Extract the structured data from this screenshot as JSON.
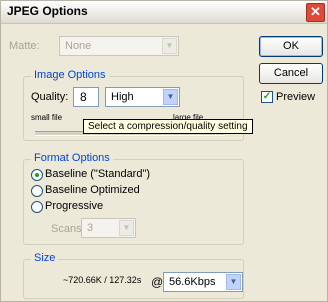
{
  "window": {
    "title": "JPEG Options",
    "close_glyph": "✕"
  },
  "matte": {
    "label": "Matte:",
    "value": "None"
  },
  "buttons": {
    "ok": "OK",
    "cancel": "Cancel"
  },
  "preview": {
    "label": "Preview",
    "checked": true,
    "check_glyph": "✓"
  },
  "image_options": {
    "legend": "Image Options",
    "quality_label": "Quality:",
    "quality_value": "8",
    "quality_select": "High",
    "small_file": "small file",
    "large_file": "large file",
    "tooltip": "Select a compression/quality setting"
  },
  "format_options": {
    "legend": "Format Options",
    "options": [
      "Baseline (\"Standard\")",
      "Baseline Optimized",
      "Progressive"
    ],
    "selected_index": 0,
    "scans_label": "Scans:",
    "scans_value": "3"
  },
  "size": {
    "legend": "Size",
    "estimate": "~720.66K / 127.32s",
    "at": "@",
    "speed": "56.6Kbps"
  },
  "icons": {
    "dropdown": "chevron-down-icon",
    "close": "close-icon"
  }
}
